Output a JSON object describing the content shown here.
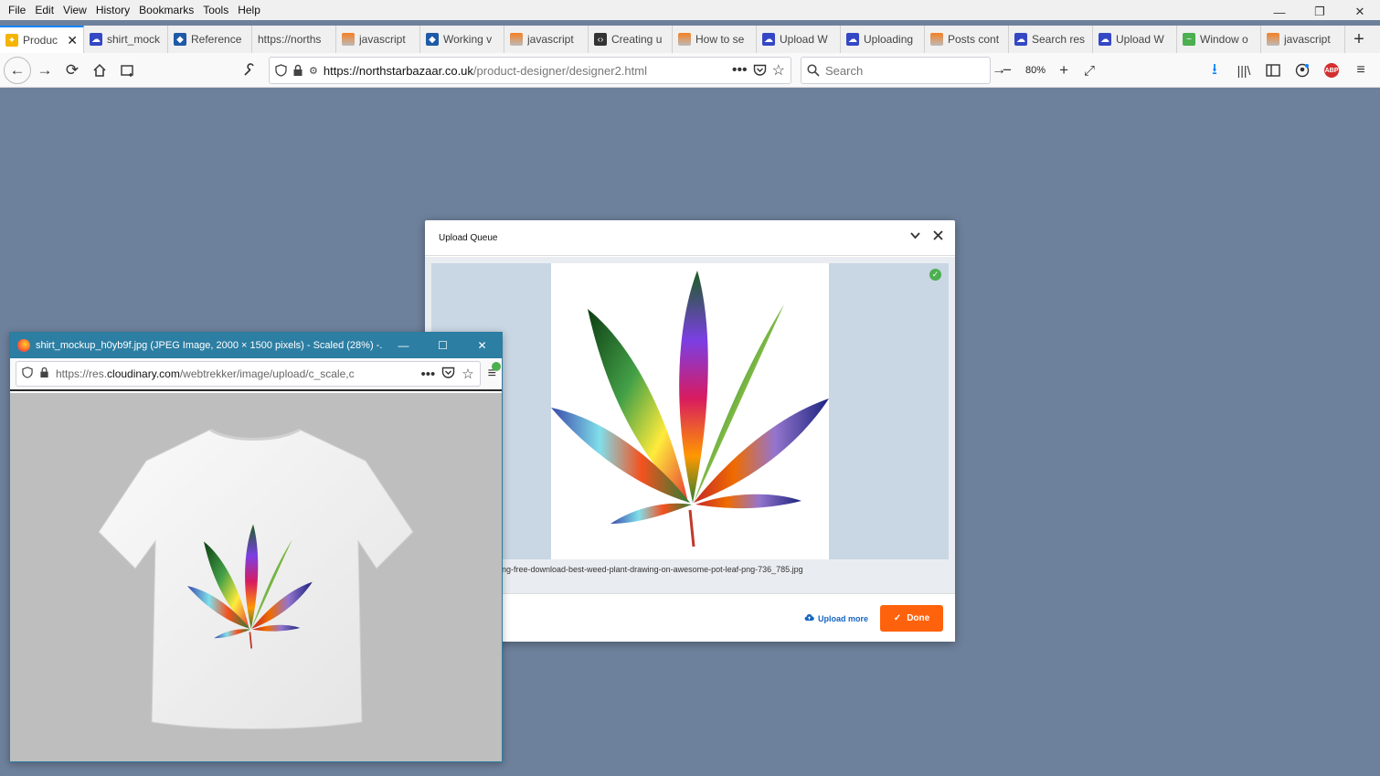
{
  "menu": [
    "File",
    "Edit",
    "View",
    "History",
    "Bookmarks",
    "Tools",
    "Help"
  ],
  "window_controls": [
    "—",
    "❐",
    "✕"
  ],
  "tabs": [
    {
      "label": "Produc",
      "icon": "star-icon",
      "active": true
    },
    {
      "label": "shirt_mock",
      "icon": "cloud-icon"
    },
    {
      "label": "Reference",
      "icon": "reference-icon"
    },
    {
      "label": "https://norths",
      "icon": ""
    },
    {
      "label": "javascript",
      "icon": "stackoverflow-icon"
    },
    {
      "label": "Working v",
      "icon": "reference-icon"
    },
    {
      "label": "javascript",
      "icon": "stackoverflow-icon"
    },
    {
      "label": "Creating u",
      "icon": "code-icon"
    },
    {
      "label": "How to se",
      "icon": "stackoverflow-icon"
    },
    {
      "label": "Upload W",
      "icon": "cloud-icon"
    },
    {
      "label": "Uploading",
      "icon": "cloud-icon"
    },
    {
      "label": "Posts cont",
      "icon": "stackoverflow-icon"
    },
    {
      "label": "Search res",
      "icon": "cloud-icon"
    },
    {
      "label": "Upload W",
      "icon": "cloud-icon"
    },
    {
      "label": "Window o",
      "icon": "window-icon"
    },
    {
      "label": "javascript",
      "icon": "stackoverflow-icon"
    }
  ],
  "navbar": {
    "url_host": "https://northstarbazaar.co.uk",
    "url_path": "/product-designer/designer2.html",
    "search_placeholder": "Search",
    "zoom": "80%"
  },
  "modal": {
    "title": "Upload Queue",
    "filename": "ng-free-download-best-weed-plant-drawing-on-awesome-pot-leaf-png-736_785.jpg",
    "upload_more": "Upload more",
    "done": "Done"
  },
  "popup": {
    "title": "shirt_mockup_h0yb9f.jpg (JPEG Image, 2000 × 1500 pixels) - Scaled (28%) -...",
    "url_prefix": "https://res.",
    "url_host": "cloudinary.com",
    "url_path": "/webtrekker/image/upload/c_scale,c"
  }
}
